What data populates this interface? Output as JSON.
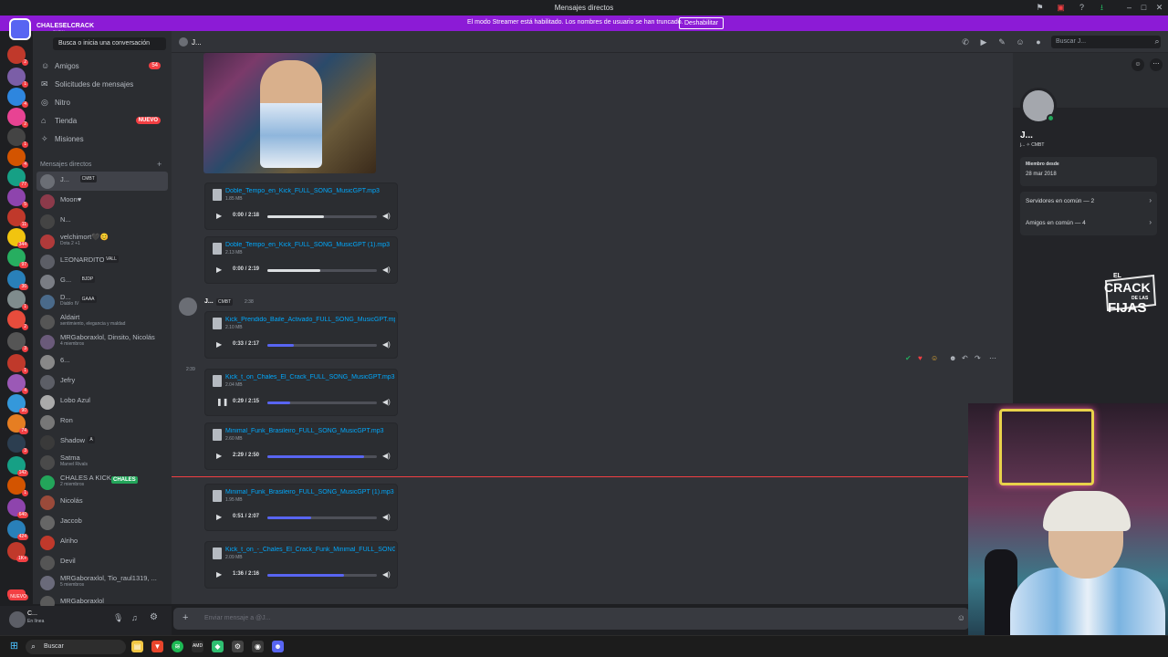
{
  "window": {
    "title": "Mensajes directos"
  },
  "banner": {
    "message": "El modo Streamer está habilitado. Los nombres de usuario se han truncado.",
    "button_label": "Deshabilitar"
  },
  "overlay": {
    "channel_name": "CHALESELCRACK",
    "channel_sub": "SHOW"
  },
  "rail": {
    "badges": [
      "2",
      "1",
      "4",
      "2",
      "1",
      "4",
      "77",
      "5",
      "11",
      "344",
      "97",
      "36",
      "1",
      "2",
      "3",
      "1",
      "4",
      "90",
      "74",
      "3",
      "142",
      "1",
      "640",
      "424",
      "1K+",
      "NUEVO"
    ]
  },
  "sidebar": {
    "search_placeholder": "Busca o inicia una conversación",
    "nav": [
      {
        "label": "Amigos",
        "icon": "friends-icon",
        "count": "54"
      },
      {
        "label": "Solicitudes de mensajes",
        "icon": "mail-icon"
      },
      {
        "label": "Nitro",
        "icon": "nitro-icon"
      },
      {
        "label": "Tienda",
        "icon": "shop-icon",
        "badge": "NUEVO"
      },
      {
        "label": "Misiones",
        "icon": "quests-icon"
      }
    ],
    "dm_header": "Mensajes directos",
    "dms": [
      {
        "name": "J...",
        "tag": "CMBT"
      },
      {
        "name": "Moon♥"
      },
      {
        "name": "N..."
      },
      {
        "name": "velchimort🖤😊",
        "sub": "Dota 2 +1"
      },
      {
        "name": "LΞONARDITO",
        "tag": "VALL"
      },
      {
        "name": "G...",
        "tag": "BJDP"
      },
      {
        "name": "D...",
        "tag": "GAAA",
        "sub": "Diablo IV"
      },
      {
        "name": "Aldairt",
        "sub": "sentimiento, elegancia y maldad"
      },
      {
        "name": "MRGaboraxlol, Dinsito, Nicolás",
        "sub": "4 miembros"
      },
      {
        "name": "6..."
      },
      {
        "name": "Jefry"
      },
      {
        "name": "Lobo Azul"
      },
      {
        "name": "Ron"
      },
      {
        "name": "Shadow",
        "tag": "A"
      },
      {
        "name": "Satma",
        "sub": "Marvel Rivals"
      },
      {
        "name": "CHALES A KICK",
        "sub": "2 miembros",
        "tag": "CHALES"
      },
      {
        "name": "Nicolás"
      },
      {
        "name": "Jaccob"
      },
      {
        "name": "Alriho"
      },
      {
        "name": "Devil"
      },
      {
        "name": "MRGaboraxlol, Tio_raul1319, ...",
        "sub": "5 miembros"
      },
      {
        "name": "MRGaboraxlol"
      }
    ]
  },
  "userpanel": {
    "name": "C...",
    "status": "En línea"
  },
  "chat": {
    "header_name": "J...",
    "search_placeholder": "Buscar J...",
    "sender": {
      "name": "J...",
      "tag": "CMBT",
      "time": "2:38"
    },
    "second_time": "2:39",
    "attachments": [
      {
        "name": "Doble_Tempo_en_Kick_FULL_SONG_MusicGPT.mp3",
        "size": "1.85 MB",
        "time": "0:00 / 2:18",
        "progress": 0.52
      },
      {
        "name": "Doble_Tempo_en_Kick_FULL_SONG_MusicGPT (1).mp3",
        "size": "2.13 MB",
        "time": "0:00 / 2:19",
        "progress": 0.48
      },
      {
        "name": "Kick_Prendido_Baile_Activado_FULL_SONG_MusicGPT.mp3",
        "size": "2.10 MB",
        "time": "0:33 / 2:17",
        "progress": 0.24
      },
      {
        "name": "Kick_t_on_Chales_El_Crack_FULL_SONG_MusicGPT.mp3",
        "size": "2.04 MB",
        "time": "0:29 / 2:15",
        "progress": 0.21,
        "playing": true
      },
      {
        "name": "Minimal_Funk_Brasileiro_FULL_SONG_MusicGPT.mp3",
        "size": "2.60 MB",
        "time": "2:29 / 2:50",
        "progress": 0.88
      },
      {
        "name": "Minimal_Funk_Brasileiro_FULL_SONG_MusicGPT (1).mp3",
        "size": "1.95 MB",
        "time": "0:51 / 2:07",
        "progress": 0.4
      },
      {
        "name": "Kick_t_on_-_Chales_El_Crack_Funk_Minimal_FULL_SONG_MusicGPT.mp3",
        "size": "2.09 MB",
        "time": "1:36 / 2:16",
        "progress": 0.7
      }
    ],
    "input_placeholder": "Enviar mensaje a @J..."
  },
  "profile": {
    "name": "J...",
    "tag_line": "CMBT",
    "member_since_title": "Miembro desde",
    "member_since": "28 mar 2018",
    "servers_common": "Servidores en común — 2",
    "friends_common": "Amigos en común — 4"
  },
  "brand": {
    "line1": "EL",
    "line2": "CRACK",
    "line3": "DE LAS",
    "line4": "FIJAS"
  },
  "taskbar": {
    "search_label": "Buscar"
  },
  "colors": {
    "accent": "#5865f2",
    "streamer_banner": "#8c1bd6",
    "link": "#00a8fc",
    "danger": "#f23f43",
    "online": "#23a55a"
  }
}
